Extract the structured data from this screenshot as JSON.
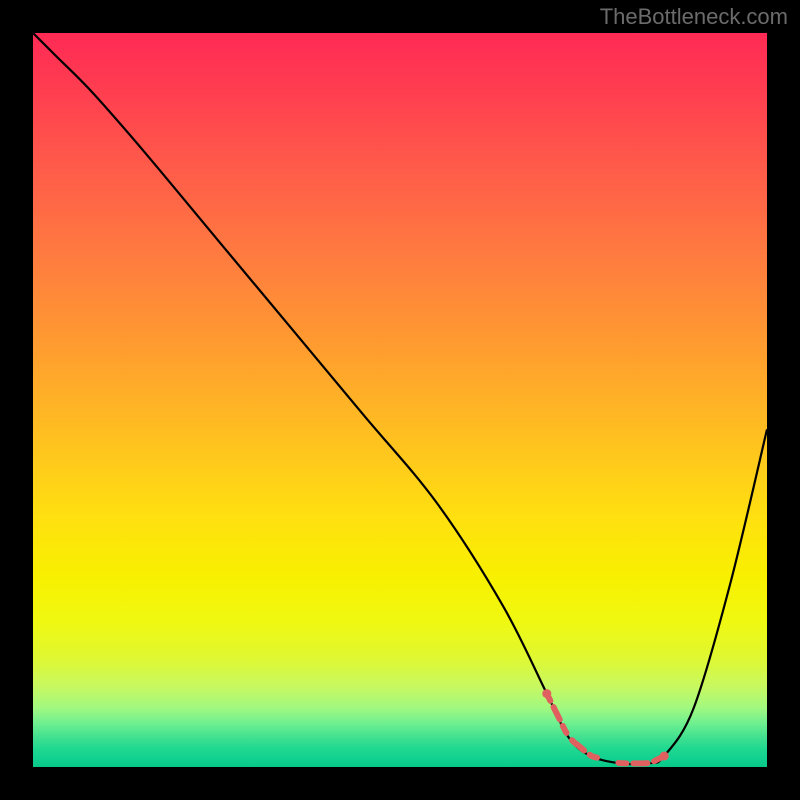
{
  "watermark": "TheBottleneck.com",
  "chart_data": {
    "type": "line",
    "title": "",
    "xlabel": "",
    "ylabel": "",
    "xlim": [
      0,
      100
    ],
    "ylim": [
      0,
      100
    ],
    "series": [
      {
        "name": "curve",
        "color": "#000000",
        "x": [
          0,
          3,
          8,
          15,
          25,
          35,
          45,
          55,
          64,
          70,
          73,
          76,
          80,
          84,
          86,
          90,
          95,
          100
        ],
        "y": [
          100,
          97,
          92,
          84,
          72,
          60,
          48,
          36,
          22,
          10,
          4,
          1.5,
          0.5,
          0.5,
          1.5,
          8,
          25,
          46
        ]
      }
    ],
    "marker_band": {
      "color": "#e06060",
      "x_start": 70,
      "x_end": 86
    },
    "gradient_stops": [
      {
        "pos": 0,
        "color": "#ff2a55"
      },
      {
        "pos": 8,
        "color": "#ff3e50"
      },
      {
        "pos": 18,
        "color": "#ff5a4a"
      },
      {
        "pos": 30,
        "color": "#ff7a40"
      },
      {
        "pos": 42,
        "color": "#ff9a30"
      },
      {
        "pos": 55,
        "color": "#ffc020"
      },
      {
        "pos": 66,
        "color": "#ffe010"
      },
      {
        "pos": 74,
        "color": "#f8f000"
      },
      {
        "pos": 80,
        "color": "#f0f810"
      },
      {
        "pos": 85,
        "color": "#e0f830"
      },
      {
        "pos": 89,
        "color": "#c8f860"
      },
      {
        "pos": 92,
        "color": "#a0f880"
      },
      {
        "pos": 94,
        "color": "#70f090"
      },
      {
        "pos": 96,
        "color": "#40e090"
      },
      {
        "pos": 97.5,
        "color": "#20d890"
      },
      {
        "pos": 99,
        "color": "#10d090"
      },
      {
        "pos": 100,
        "color": "#08c888"
      }
    ]
  }
}
